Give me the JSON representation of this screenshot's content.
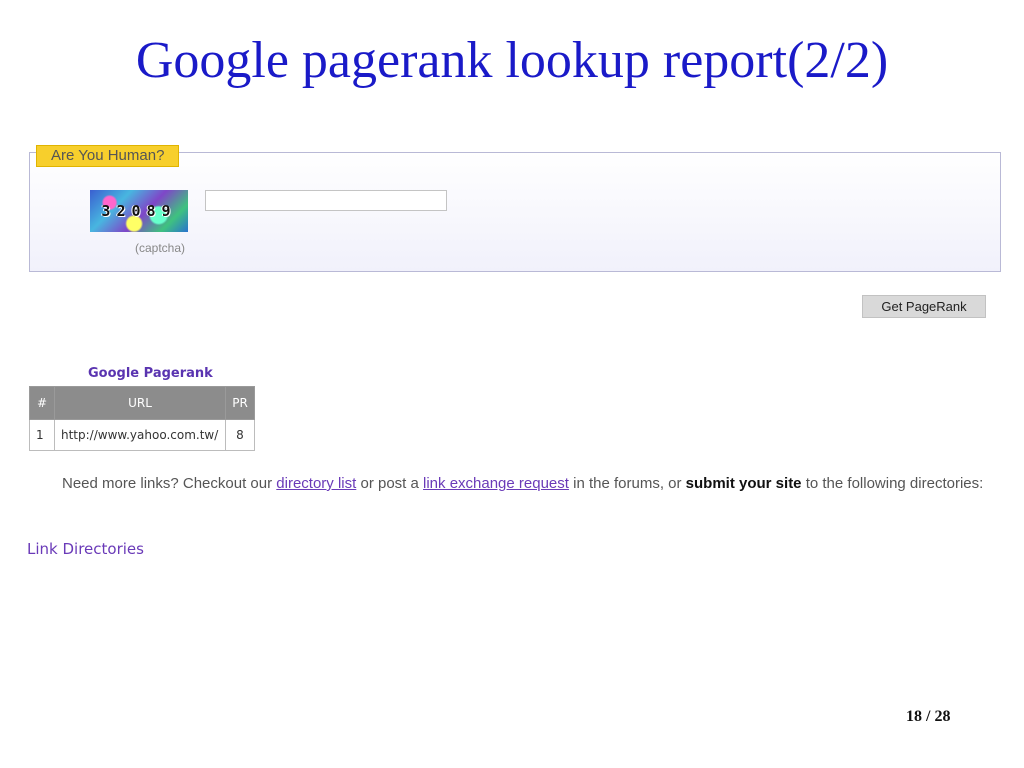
{
  "slide": {
    "title": "Google pagerank lookup report(2/2)",
    "page_number": "18 / 28"
  },
  "captcha_box": {
    "legend": "Are You Human?",
    "code": "32089",
    "caption": "(captcha)",
    "input_value": ""
  },
  "button": {
    "label": "Get PageRank"
  },
  "results": {
    "title": "Google Pagerank",
    "headers": [
      "#",
      "URL",
      "PR"
    ],
    "rows": [
      {
        "index": "1",
        "url": "http://www.yahoo.com.tw/",
        "pr": "8"
      }
    ]
  },
  "paragraph": {
    "part1": "Need more links? Checkout our ",
    "link1": "directory list",
    "part2": " or post a ",
    "link2": "link exchange request",
    "part3": " in the forums, or ",
    "bold": "submit your site",
    "part4": " to the following directories:"
  },
  "link_directories": "Link Directories",
  "colors": {
    "title_blue": "#1a1ac8",
    "legend_yellow": "#f7cf2c",
    "link_purple": "#6a3ab8",
    "table_header_gray": "#8c8c8c"
  }
}
